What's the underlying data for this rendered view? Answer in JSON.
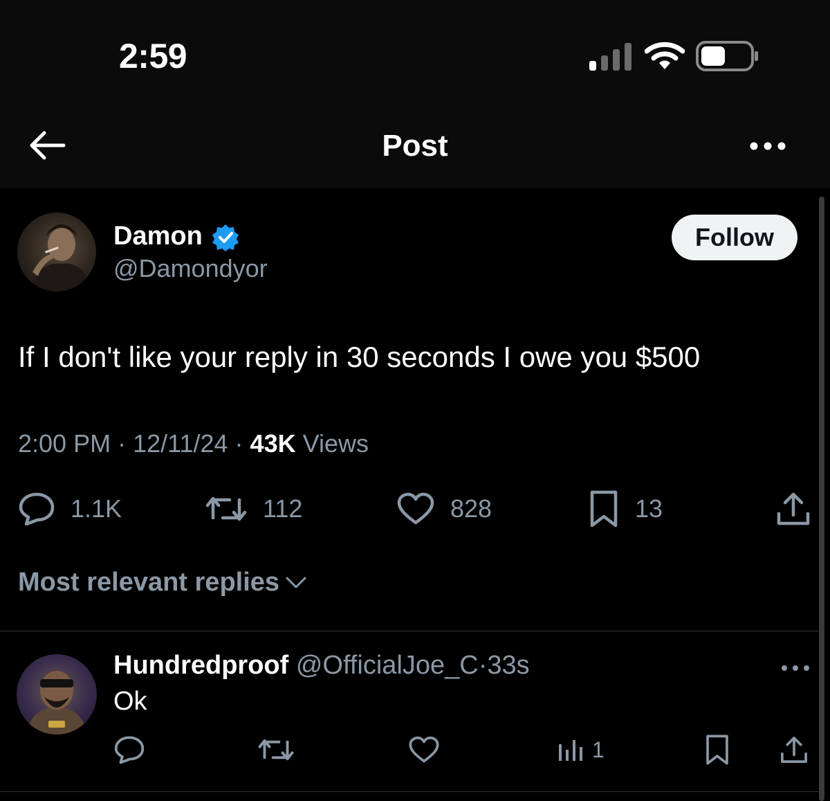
{
  "status_bar": {
    "time": "2:59"
  },
  "header": {
    "title": "Post"
  },
  "post": {
    "author_name": "Damon",
    "author_handle": "@Damondyor",
    "follow_label": "Follow",
    "text": "If I don't like your reply in 30 seconds I owe you $500",
    "time": "2:00 PM",
    "date": "12/11/24",
    "views_count": "43K",
    "views_label": "Views",
    "stats": {
      "replies": "1.1K",
      "reposts": "112",
      "likes": "828",
      "bookmarks": "13"
    }
  },
  "sort": {
    "label": "Most relevant replies"
  },
  "reply": {
    "author_name": "Hundredproof",
    "author_handle": "@OfficialJoe_C",
    "age": "33s",
    "text": "Ok",
    "views": "1"
  },
  "colors": {
    "background": "#000000",
    "text_primary": "#e7e9ea",
    "text_secondary": "#8b98a5",
    "verified_blue": "#1d9bf0",
    "follow_button": "#eff3f4"
  }
}
